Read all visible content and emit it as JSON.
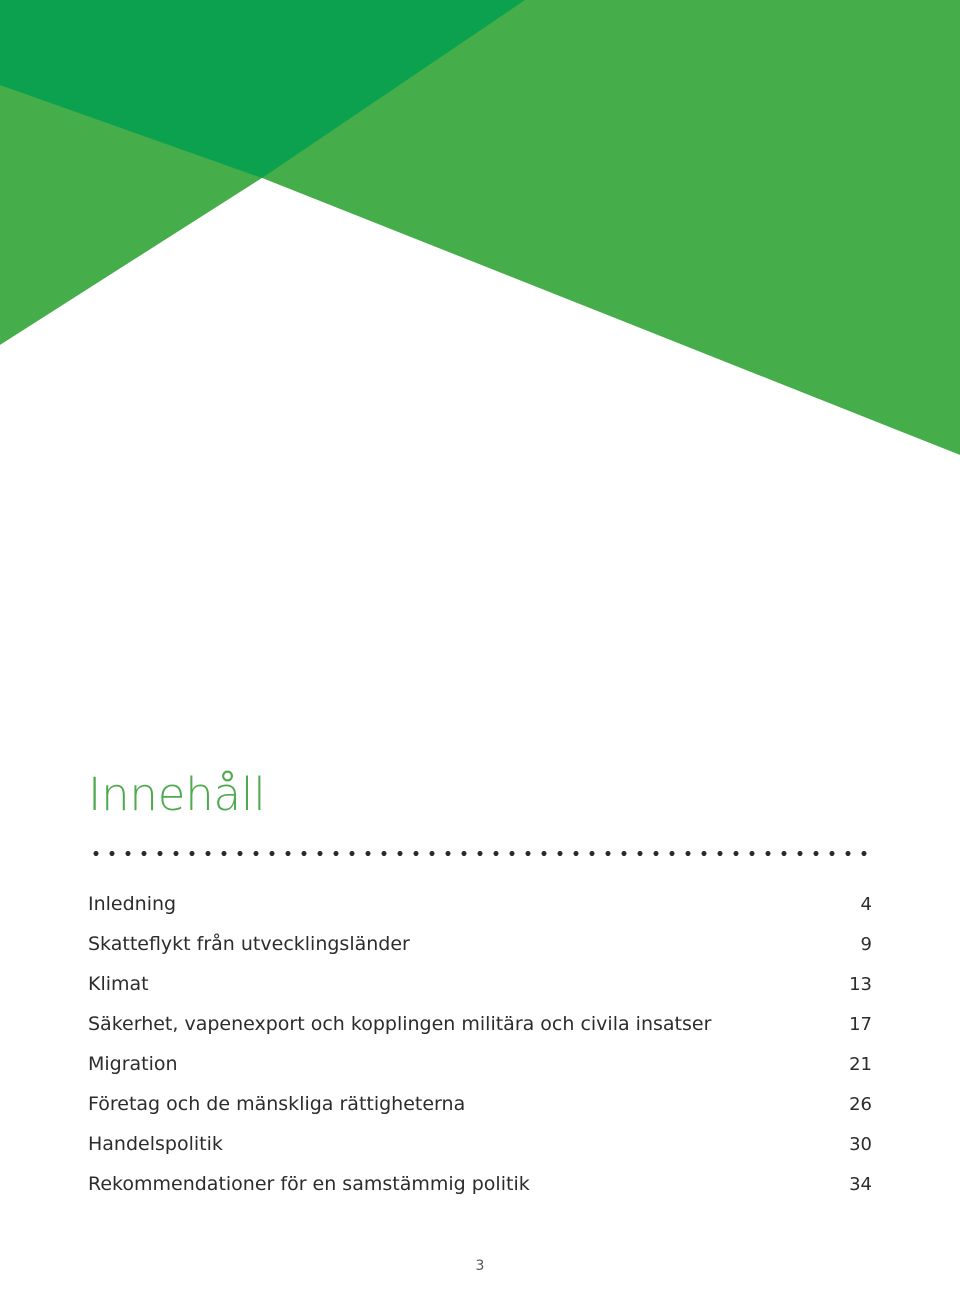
{
  "document": {
    "title": "Innehåll",
    "folio": "3"
  },
  "cover_art": {
    "name": "geometric-green-banner",
    "colors": {
      "dark_green": "#0ba14f",
      "light_green": "#45ad49",
      "white": "#ffffff"
    }
  },
  "divider": {
    "style": "dotted",
    "color": "#2b2b2b"
  },
  "toc": {
    "entries": [
      {
        "label": "Inledning",
        "page": "4"
      },
      {
        "label": "Skatteflykt från utvecklingsländer",
        "page": "9"
      },
      {
        "label": "Klimat",
        "page": "13"
      },
      {
        "label": "Säkerhet, vapenexport och kopplingen militära och civila insatser",
        "page": "17"
      },
      {
        "label": "Migration",
        "page": "21"
      },
      {
        "label": "Företag och de mänskliga rättigheterna",
        "page": "26"
      },
      {
        "label": "Handelspolitik",
        "page": "30"
      },
      {
        "label": "Rekommendationer för en samstämmig politik",
        "page": "34"
      }
    ]
  },
  "theme": {
    "title_color": "#4fa94f",
    "text_color": "#2c2c2c",
    "folio_color": "#555555"
  }
}
